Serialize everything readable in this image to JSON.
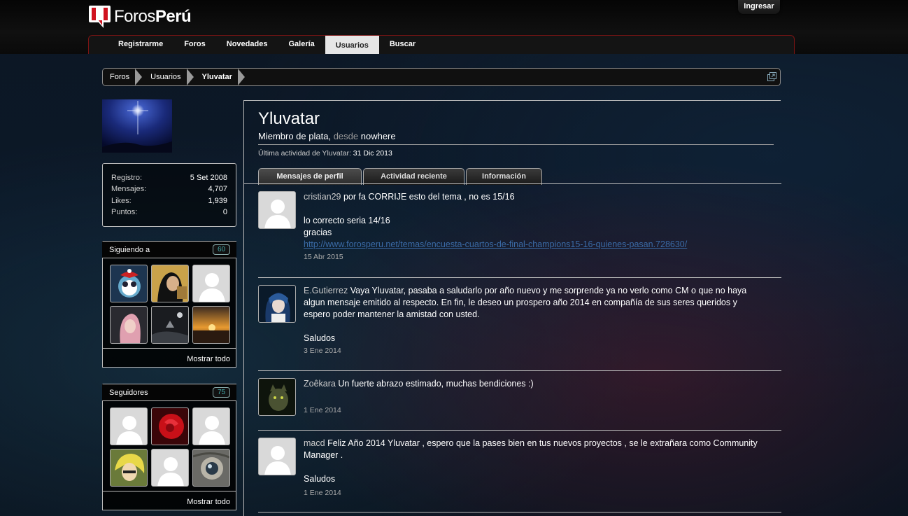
{
  "header": {
    "logo_text_regular": "Foros",
    "logo_text_bold": "Perú",
    "login_label": "Ingresar"
  },
  "nav": {
    "tabs": [
      "Registrarme",
      "Foros",
      "Novedades",
      "Galería",
      "Usuarios",
      "Buscar"
    ],
    "active_index": 4
  },
  "breadcrumb": [
    "Foros",
    "Usuarios",
    "Yluvatar"
  ],
  "profile": {
    "username": "Yluvatar",
    "rank": "Miembro de plata,",
    "since_label": "desde",
    "since_value": "nowhere",
    "last_activity_label": "Última actividad de Yluvatar:",
    "last_activity_value": "31 Dic 2013"
  },
  "stats": [
    {
      "label": "Registro:",
      "value": "5 Set 2008"
    },
    {
      "label": "Mensajes:",
      "value": "4,707"
    },
    {
      "label": "Likes:",
      "value": "1,939"
    },
    {
      "label": "Puntos:",
      "value": "0"
    }
  ],
  "following": {
    "title": "Siguiendo a",
    "count": "60",
    "show_all": "Mostrar todo"
  },
  "followers": {
    "title": "Seguidores",
    "count": "75",
    "show_all": "Mostrar todo"
  },
  "profile_tabs": [
    "Mensajes de perfil",
    "Actividad reciente",
    "Información"
  ],
  "posts": [
    {
      "author": "cristian29",
      "lines": [
        "por fa CORRIJE esto del tema , no es 15/16",
        "",
        "lo correcto seria 14/16",
        "gracias"
      ],
      "link": "http://www.forosperu.net/temas/encuesta-cuartos-de-final-champions15-16-quienes-pasan.728630/",
      "date": "15 Abr 2015"
    },
    {
      "author": "E.Gutierrez",
      "lines": [
        "Vaya Yluvatar, pasaba a saludarlo por año nuevo y me sorprende ya no verlo como CM o que no haya",
        "algun mensaje emitido al respecto. En fin, le deseo un prospero año 2014 en compañía de sus seres queridos y",
        "espero poder mantener la amistad con usted.",
        "",
        "Saludos"
      ],
      "date": "3 Ene 2014"
    },
    {
      "author": "Zoêkara",
      "lines": [
        "Un fuerte abrazo estimado, muchas bendiciones :)"
      ],
      "date": "1 Ene 2014"
    },
    {
      "author": "macd",
      "lines": [
        "Feliz Año 2014 Yluvatar , espero que la pases bien en tus nuevos proyectos , se le extrañara como Community",
        "Manager .",
        "",
        "Saludos"
      ],
      "date": "1 Ene 2014"
    }
  ],
  "colors": {
    "accent_red": "#c8102e",
    "badge_teal": "#44aaaa",
    "link_blue": "#3a6aa6"
  }
}
